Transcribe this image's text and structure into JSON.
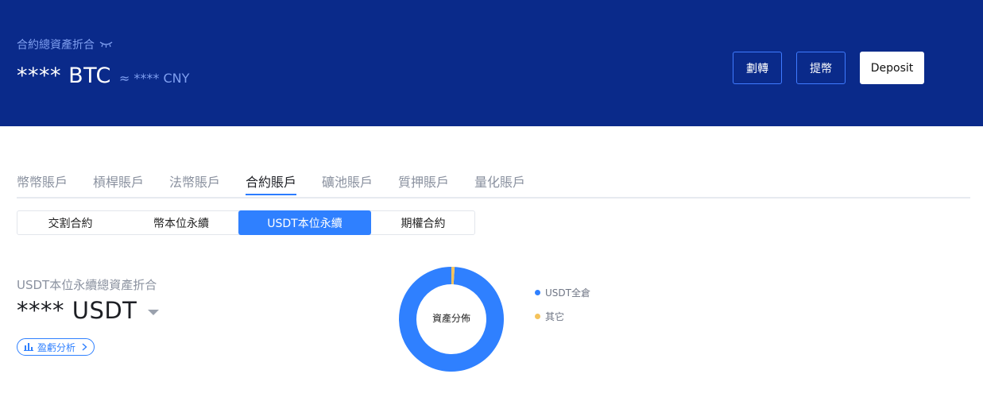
{
  "header": {
    "label": "合約總資產折合",
    "main_value": "**** BTC",
    "approx_value": "≈ **** CNY",
    "buttons": {
      "transfer": "劃轉",
      "withdraw": "提幣",
      "deposit": "Deposit"
    }
  },
  "account_tabs": [
    "幣幣賬戶",
    "槓桿賬戶",
    "法幣賬戶",
    "合約賬戶",
    "礦池賬戶",
    "質押賬戶",
    "量化賬戶"
  ],
  "active_account_tab": "合約賬戶",
  "sub_tabs": [
    "交割合約",
    "幣本位永續",
    "USDT本位永續",
    "期權合約"
  ],
  "active_sub_tab": "USDT本位永續",
  "summary": {
    "title": "USDT本位永續總資產折合",
    "value": "**** USDT",
    "pnl_button": "盈虧分析"
  },
  "distribution": {
    "center_label": "資產分佈",
    "legend": [
      {
        "name": "USDT全倉",
        "color": "#2f80ff",
        "share": 0.99
      },
      {
        "name": "其它",
        "color": "#f5c35b",
        "share": 0.01
      }
    ]
  },
  "colors": {
    "header_bg": "#0a2a8a",
    "accent": "#2f80ff",
    "other": "#f5c35b"
  }
}
